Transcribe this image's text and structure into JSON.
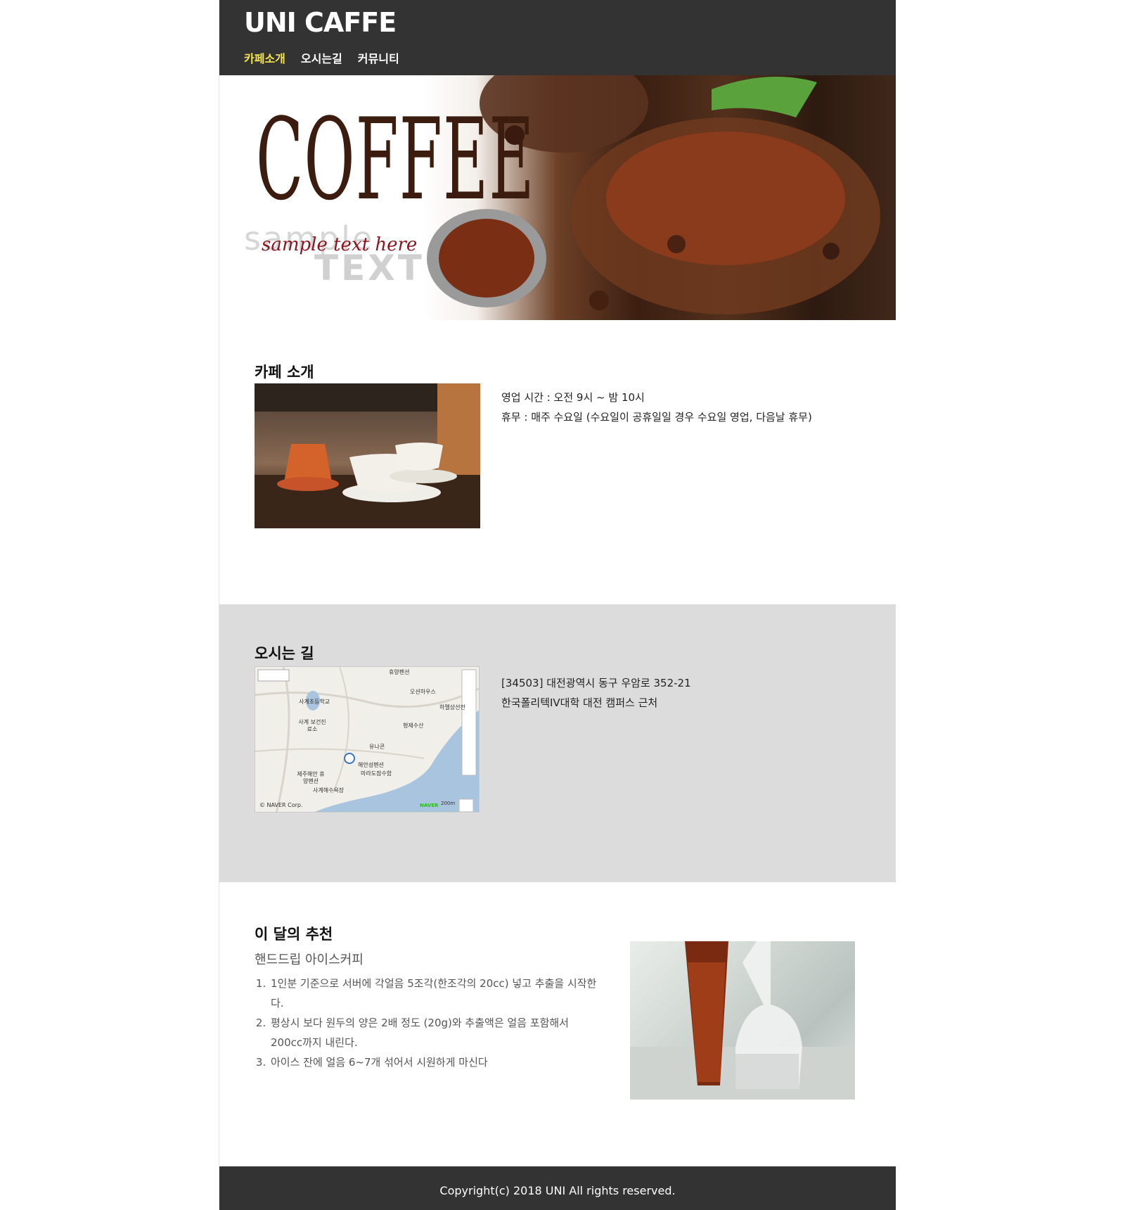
{
  "header": {
    "logo": "UNI CAFFE",
    "nav": [
      {
        "label": "카페소개",
        "active": true
      },
      {
        "label": "오시는길",
        "active": false
      },
      {
        "label": "커뮤니티",
        "active": false
      }
    ]
  },
  "hero": {
    "title": "COFFEE",
    "ghost_line1": "sample",
    "ghost_line2": "TEXT",
    "script": "sample text here"
  },
  "about": {
    "title": "카페 소개",
    "hours": "영업 시간 : 오전 9시 ~ 밤 10시",
    "closed": "휴무 : 매주 수요일 (수요일이 공휴일일 경우 수요일 영업, 다음날 휴무)"
  },
  "location": {
    "title": "오시는 길",
    "address": "[34503] 대전광역시 동구 우암로 352-21",
    "near": "한국폴리텍IV대학 대전 캠퍼스 근처",
    "map": {
      "labels": [
        "휴양펜션",
        "오션하우스",
        "사계초등학교",
        "하멜상선전",
        "사계 보건진료소",
        "형제수산",
        "유나콘",
        "제주해안 휴양펜션",
        "해안성펜션",
        "마라도잠수함",
        "사계해수욕장"
      ],
      "copyright": "© NAVER Corp.",
      "brand": "NAVER",
      "scale": "200m"
    }
  },
  "recommend": {
    "title": "이 달의 추천",
    "subtitle": "핸드드립 아이스커피",
    "steps": [
      "1인분 기준으로 서버에 각얼음 5조각(한조각의 20cc) 넣고 추출을 시작한다.",
      "평상시 보다 원두의 양은 2배 정도 (20g)와 추출액은 얼음 포함해서 200cc까지 내린다.",
      "아이스 잔에 얼음 6~7개 섞어서 시원하게 마신다"
    ]
  },
  "footer": {
    "copyright": "Copyright(c) 2018 UNI All rights reserved."
  },
  "colors": {
    "header_bg": "#333333",
    "nav_active": "#f5e34b",
    "section_gray": "#dcdcdc",
    "hero_title": "#3c1c0e"
  }
}
